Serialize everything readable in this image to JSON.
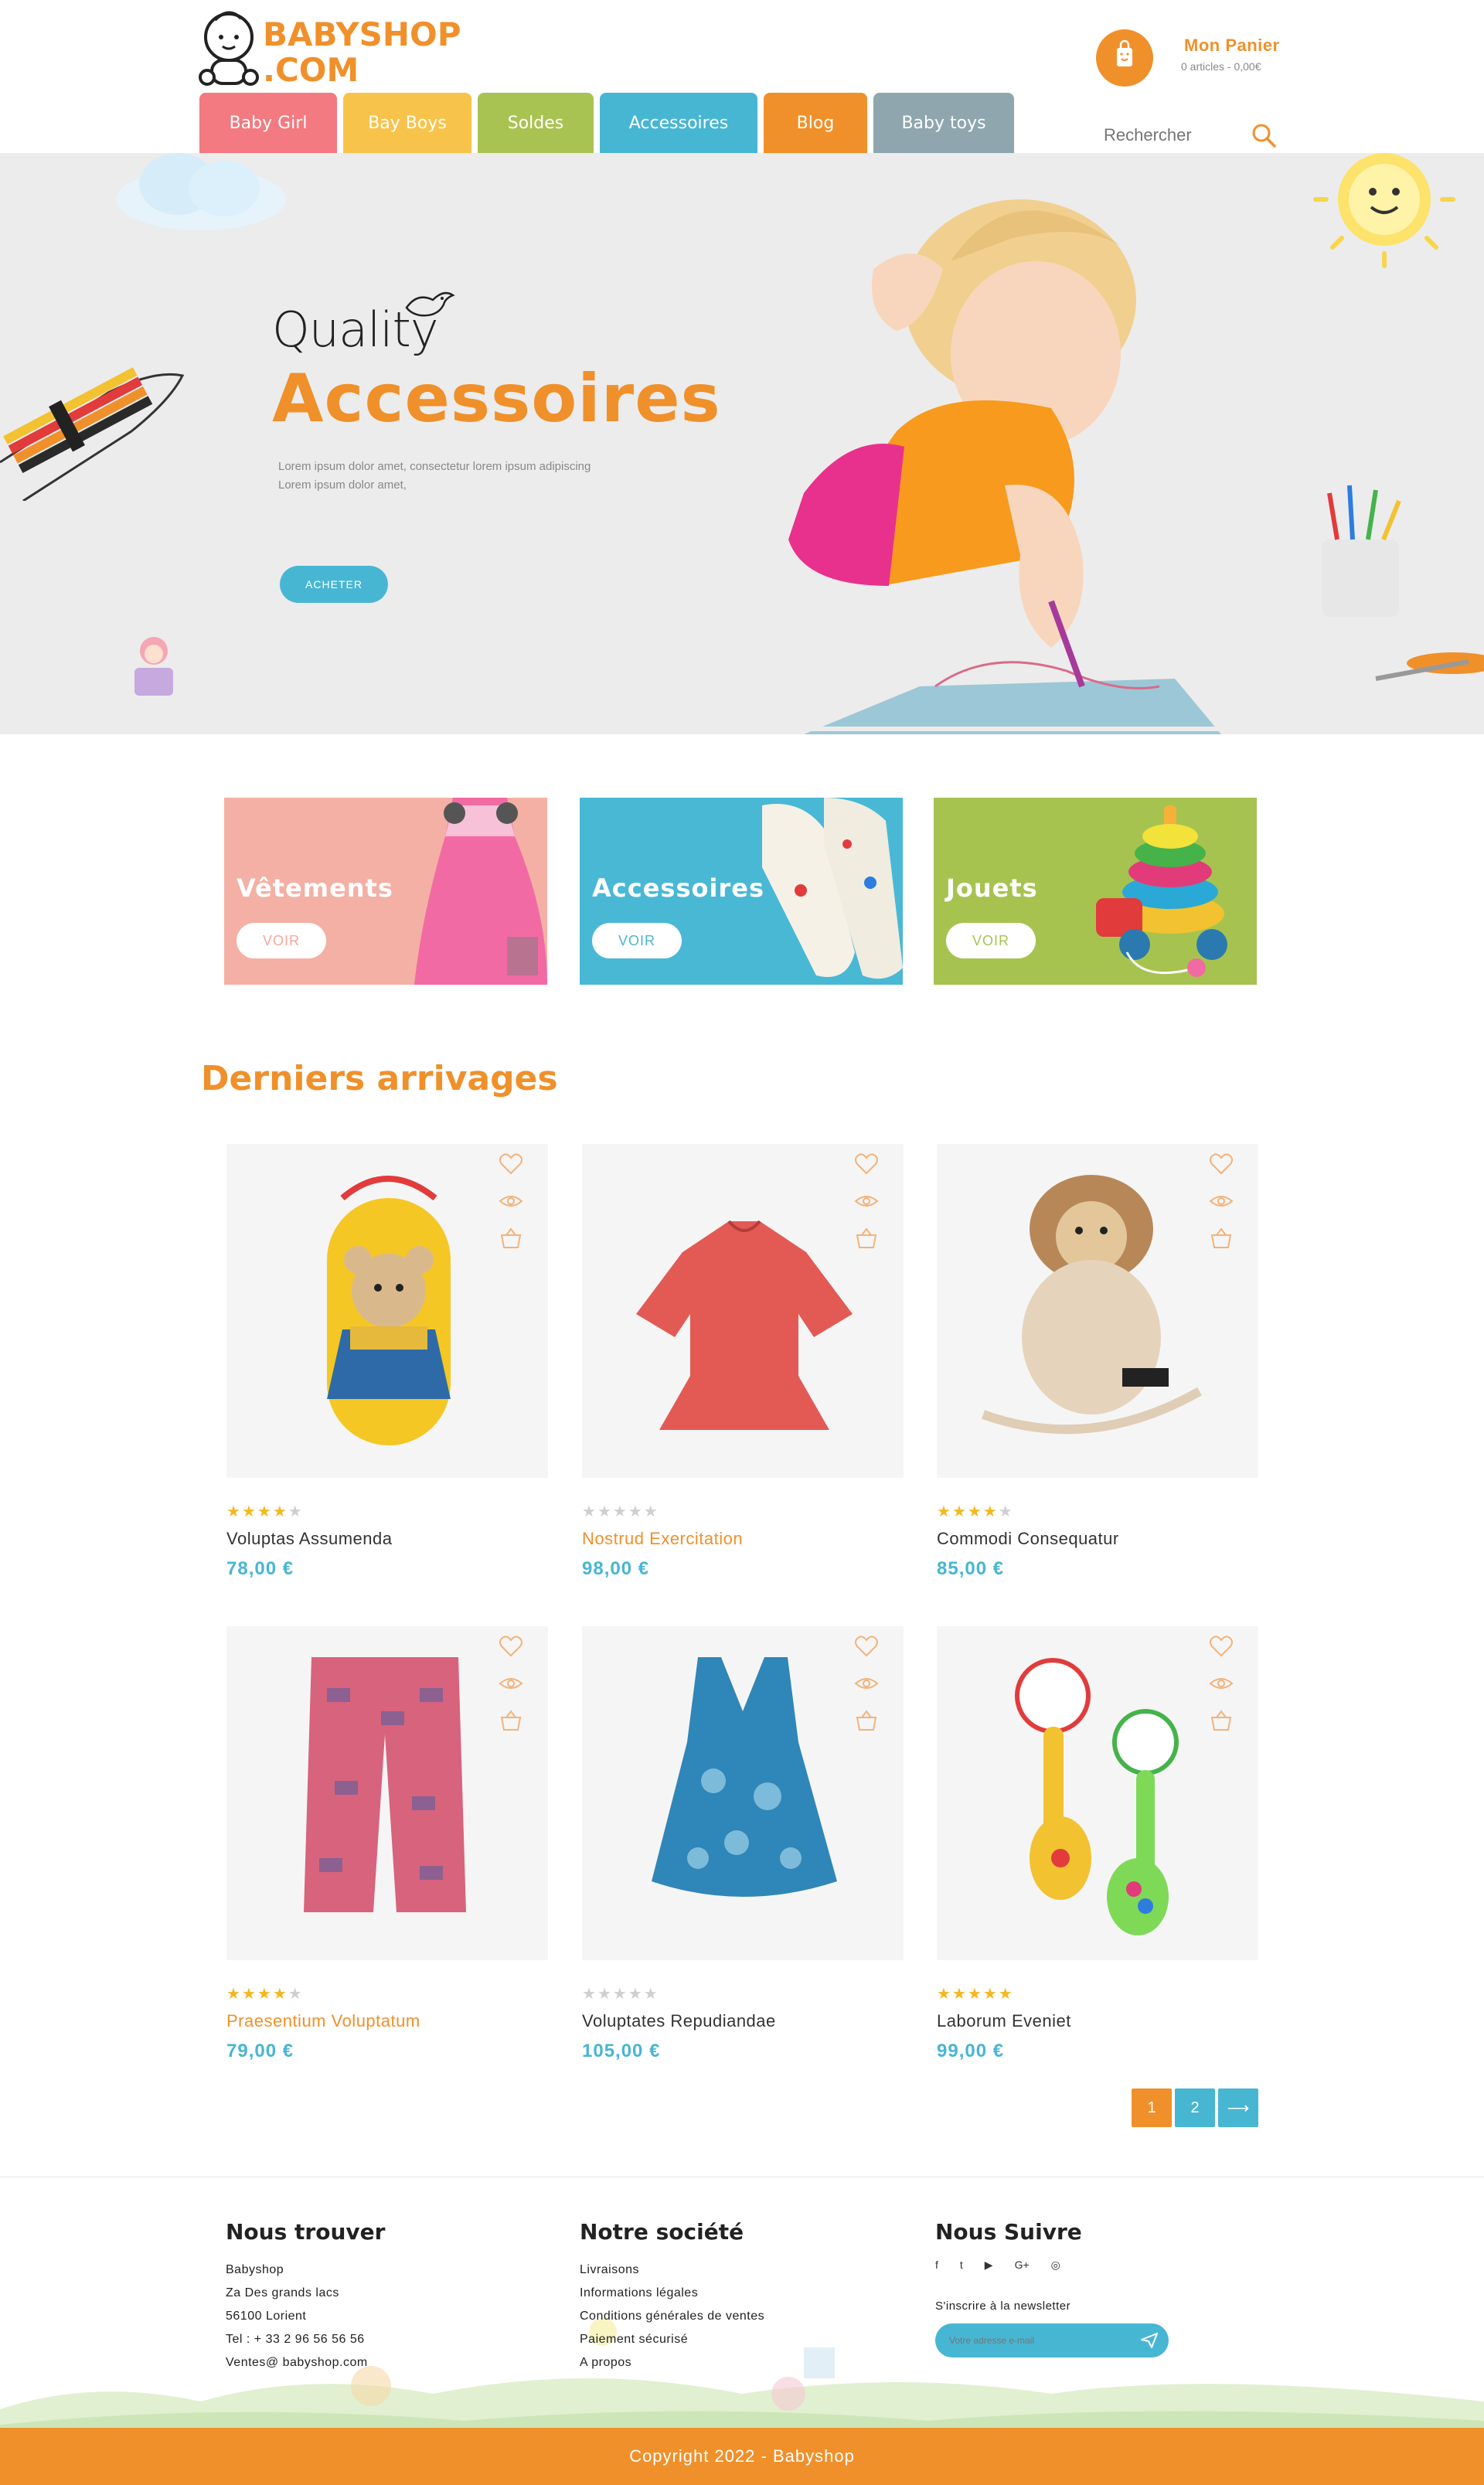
{
  "brand": {
    "name_line1": "BABYSHOP",
    "name_line2": ".COM",
    "accent": "#f0902a",
    "secondary": "#47b6d3"
  },
  "cart": {
    "title": "Mon Panier",
    "summary": "0 articles - 0,00€"
  },
  "nav": [
    {
      "label": "Baby Girl",
      "color": "#f27a80"
    },
    {
      "label": "Bay Boys",
      "color": "#f8c34a"
    },
    {
      "label": "Soldes",
      "color": "#a9c353"
    },
    {
      "label": "Accessoires",
      "color": "#47b6d3"
    },
    {
      "label": "Blog",
      "color": "#f0902a"
    },
    {
      "label": "Baby toys",
      "color": "#8fa6ae"
    }
  ],
  "search": {
    "placeholder": "Rechercher",
    "icon": "search-icon"
  },
  "hero": {
    "kicker": "Quality",
    "title": "Accessoires",
    "text_line1": "Lorem ipsum dolor amet, consectetur lorem ipsum adipiscing",
    "text_line2": "Lorem ipsum dolor amet,",
    "button": "ACHETER"
  },
  "categories": [
    {
      "title": "Vêtements",
      "button": "VOIR",
      "color": "#f4b0a4",
      "btn_color": "#f4a89a"
    },
    {
      "title": "Accessoires",
      "button": "VOIR",
      "color": "#49b8d5",
      "btn_color": "#47b6d3"
    },
    {
      "title": "Jouets",
      "button": "VOIR",
      "color": "#a6c350",
      "btn_color": "#a6c350"
    }
  ],
  "section_title": "Derniers arrivages",
  "products": [
    {
      "name": "Voluptas Assumenda",
      "price": "78,00 €",
      "rating": 4,
      "highlight": false,
      "image": "teddy-backpack"
    },
    {
      "name": "Nostrud Exercitation",
      "price": "98,00 €",
      "rating": 0,
      "highlight": true,
      "image": "red-dress"
    },
    {
      "name": "Commodi Consequatur",
      "price": "85,00 €",
      "rating": 4,
      "highlight": false,
      "image": "lion-backpack"
    },
    {
      "name": "Praesentium Voluptatum",
      "price": "79,00 €",
      "rating": 4,
      "highlight": true,
      "image": "pink-shorts"
    },
    {
      "name": "Voluptates Repudiandae",
      "price": "105,00 €",
      "rating": 0,
      "highlight": false,
      "image": "blue-top"
    },
    {
      "name": "Laborum Eveniet",
      "price": "99,00 €",
      "rating": 5,
      "highlight": false,
      "image": "baby-rattles"
    }
  ],
  "pagination": {
    "pages": [
      "1",
      "2"
    ],
    "next": "⟶",
    "current": "1"
  },
  "footer": {
    "col1": {
      "title": "Nous trouver",
      "lines": [
        "Babyshop",
        "Za Des grands lacs",
        "56100 Lorient",
        "Tel : + 33 2 96 56 56 56",
        "Ventes@ babyshop.com"
      ]
    },
    "col2": {
      "title": "Notre société",
      "lines": [
        "Livraisons",
        "Informations légales",
        "Conditions générales de ventes",
        "Paiement sécurisé",
        "A propos"
      ]
    },
    "col3": {
      "title": "Nous Suivre",
      "social": [
        "f",
        "t",
        "▶",
        "G+",
        "◎"
      ],
      "newsletter_label": "S'inscrire à la newsletter",
      "newsletter_placeholder": "Votre adresse e-mail"
    }
  },
  "copyright": "Copyright 2022 - Babyshop"
}
